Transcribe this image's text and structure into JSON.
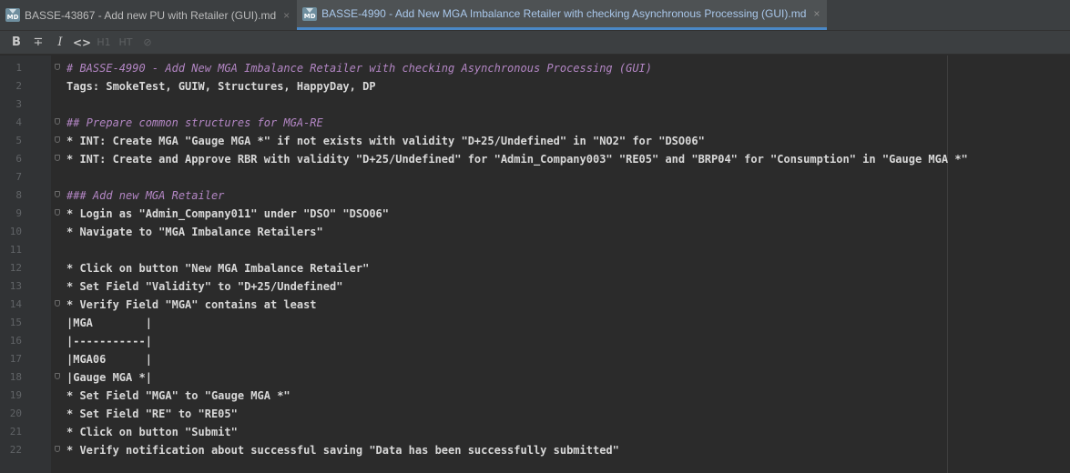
{
  "tabs": [
    {
      "label": "BASSE-43867 - Add new PU with Retailer (GUI).md",
      "icon": "markdown-file-icon",
      "icon_text": "MD",
      "active": false
    },
    {
      "label": "BASSE-4990 - Add New MGA Imbalance Retailer with checking Asynchronous Processing (GUI).md",
      "icon": "markdown-file-icon",
      "icon_text": "MD",
      "active": true
    }
  ],
  "toolbar": {
    "bold": "B",
    "strikethrough": "∓",
    "italic": "I",
    "code": "<>",
    "header_1": "H1",
    "header_2": "HT",
    "link": "⊘"
  },
  "editor": {
    "lines": [
      {
        "n": "1",
        "text": "# BASSE-4990 - Add New MGA Imbalance Retailer with checking Asynchronous Processing (GUI)",
        "kind": "heading",
        "fold": true
      },
      {
        "n": "2",
        "text": "Tags: SmokeTest, GUIW, Structures, HappyDay, DP",
        "kind": "text",
        "fold": false
      },
      {
        "n": "3",
        "text": "",
        "kind": "text",
        "fold": false
      },
      {
        "n": "4",
        "text": "## Prepare common structures for MGA-RE",
        "kind": "heading",
        "fold": true
      },
      {
        "n": "5",
        "text": "* INT: Create MGA \"Gauge MGA *\" if not exists with validity \"D+25/Undefined\" in \"NO2\" for \"DSO06\"",
        "kind": "text",
        "fold": true
      },
      {
        "n": "6",
        "text": "* INT: Create and Approve RBR with validity \"D+25/Undefined\" for \"Admin_Company003\" \"RE05\" and \"BRP04\" for \"Consumption\" in \"Gauge MGA *\"",
        "kind": "text",
        "fold": true
      },
      {
        "n": "7",
        "text": "",
        "kind": "text",
        "fold": false
      },
      {
        "n": "8",
        "text": "### Add new MGA Retailer",
        "kind": "heading",
        "fold": true
      },
      {
        "n": "9",
        "text": "* Login as \"Admin_Company011\" under \"DSO\" \"DSO06\"",
        "kind": "text",
        "fold": true
      },
      {
        "n": "10",
        "text": "* Navigate to \"MGA Imbalance Retailers\"",
        "kind": "text",
        "fold": false
      },
      {
        "n": "11",
        "text": "",
        "kind": "text",
        "fold": false
      },
      {
        "n": "12",
        "text": "* Click on button \"New MGA Imbalance Retailer\"",
        "kind": "text",
        "fold": false
      },
      {
        "n": "13",
        "text": "* Set Field \"Validity\" to \"D+25/Undefined\"",
        "kind": "text",
        "fold": false
      },
      {
        "n": "14",
        "text": "* Verify Field \"MGA\" contains at least",
        "kind": "text",
        "fold": true
      },
      {
        "n": "15",
        "text": "|MGA        |",
        "kind": "text",
        "fold": false
      },
      {
        "n": "16",
        "text": "|-----------|",
        "kind": "text",
        "fold": false
      },
      {
        "n": "17",
        "text": "|MGA06      |",
        "kind": "text",
        "fold": false
      },
      {
        "n": "18",
        "text": "|Gauge MGA *|",
        "kind": "text",
        "fold": true
      },
      {
        "n": "19",
        "text": "* Set Field \"MGA\" to \"Gauge MGA *\"",
        "kind": "text",
        "fold": false
      },
      {
        "n": "20",
        "text": "* Set Field \"RE\" to \"RE05\"",
        "kind": "text",
        "fold": false
      },
      {
        "n": "21",
        "text": "* Click on button \"Submit\"",
        "kind": "text",
        "fold": false
      },
      {
        "n": "22",
        "text": "* Verify notification about successful saving \"Data has been successfully submitted\"",
        "kind": "text",
        "fold": true
      }
    ]
  },
  "colors": {
    "background": "#2b2b2b",
    "gutter": "#313335",
    "heading": "#b386c4",
    "text": "#d8d8d8",
    "line_number": "#606366",
    "tab_active_accent": "#4a88c7"
  }
}
